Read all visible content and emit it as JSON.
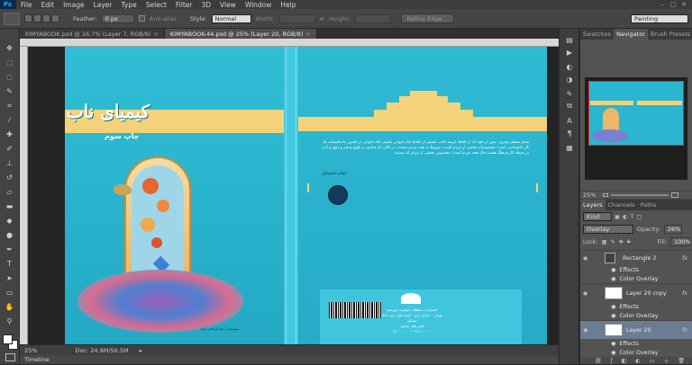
{
  "app": {
    "logo": "Ps"
  },
  "menu": [
    "File",
    "Edit",
    "Image",
    "Layer",
    "Type",
    "Select",
    "Filter",
    "3D",
    "View",
    "Window",
    "Help"
  ],
  "window_controls": [
    "–",
    "□",
    "✕"
  ],
  "options": {
    "feather_label": "Feather:",
    "feather_value": "0 px",
    "antialias_label": "Anti-alias",
    "style_label": "Style:",
    "style_value": "Normal",
    "width_label": "Width:",
    "height_label": "Height:",
    "refine_edge": "Refine Edge...",
    "workspace": "Painting"
  },
  "tabs": [
    {
      "label": "KIMYABOOK.psd @ 16.7% (Layer 7, RGB/8)",
      "close": "×",
      "active": false
    },
    {
      "label": "KIMYABOOK-44.psd @ 25% (Layer 20, RGB/8)",
      "close": "×",
      "active": true
    }
  ],
  "cover": {
    "title": "کیمیای ناب",
    "edition": "چاپ سوم",
    "author_small": "نویسنده: رضا صادقی زاده",
    "back_text": "مقام معظم رهبری: بیش از آنچه که از لحاظ عرضه کتاب عقبیم، از لحاظ کتاب‌خوانی عقبیم. کتاب‌خوانی در کشور ما متأسفانه یک کار اختصاصی است؛ مخصوصان بخشی از مردم است. مربوط به همه مردم نیست. در حالی که معارف و علوم و هنر و ذوق و ادب در حیطه کار فرهنگ هست مال همه مردم است؛ مخصوص بخشی از مردم که نیست.",
    "signature": "امام خامنه‌ای",
    "publisher_lines": [
      "انتشارات سلطان جواهره خورشید",
      "تهران – خیابان ارم – کوچه اول جنب بانک مسکن",
      "تلفن های تماس:",
      "۰۹۱۲۰۰۰۰۰۰ – ۰۲۱۰۰۰۰۰۰"
    ]
  },
  "status": {
    "zoom": "25%",
    "doc": "Doc: 24.9M/56.5M",
    "arrow": "▸"
  },
  "timeline_label": "Timeline",
  "right": {
    "panel_tabs": [
      "Swatches",
      "Navigator",
      "Brush Presets"
    ],
    "nav_zoom": "25%",
    "layers_tabs": [
      "Layers",
      "Channels",
      "Paths"
    ],
    "kind_label": "Kind",
    "blend_mode": "Overlay",
    "opacity_label": "Opacity:",
    "opacity_value": "26%",
    "lock_label": "Lock:",
    "fill_label": "Fill:",
    "fill_value": "100%",
    "layers": [
      {
        "name": "Rectangle 2",
        "kind": "shape",
        "fx": "fx"
      },
      {
        "name": "Effects",
        "kind": "effects"
      },
      {
        "name": "Color Overlay",
        "kind": "effect"
      },
      {
        "name": "Layer 20 copy",
        "kind": "layer",
        "fx": "fx"
      },
      {
        "name": "Effects",
        "kind": "effects"
      },
      {
        "name": "Color Overlay",
        "kind": "effect"
      },
      {
        "name": "Layer 20",
        "kind": "layer",
        "fx": "fx"
      },
      {
        "name": "Effects",
        "kind": "effects"
      },
      {
        "name": "Color Overlay",
        "kind": "effect"
      }
    ]
  },
  "colors": {
    "teal": "#2bb5cf",
    "band": "#f3d27a",
    "panel": "#535353"
  }
}
